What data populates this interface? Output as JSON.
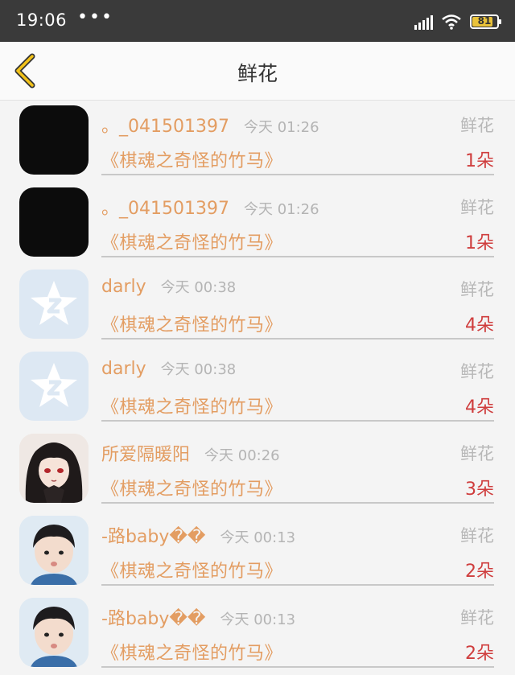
{
  "status": {
    "time": "19:06",
    "dots": "•••",
    "battery": "81"
  },
  "header": {
    "title": "鲜花"
  },
  "items": [
    {
      "avatar": "black",
      "name": "。_041501397",
      "time": "今天 01:26",
      "type": "鲜花",
      "book": "《棋魂之奇怪的竹马》",
      "count": "1朵"
    },
    {
      "avatar": "black",
      "name": "。_041501397",
      "time": "今天 01:26",
      "type": "鲜花",
      "book": "《棋魂之奇怪的竹马》",
      "count": "1朵"
    },
    {
      "avatar": "qq-default",
      "name": "darly",
      "time": "今天 00:38",
      "type": "鲜花",
      "book": "《棋魂之奇怪的竹马》",
      "count": "4朵"
    },
    {
      "avatar": "qq-default",
      "name": "darly",
      "time": "今天 00:38",
      "type": "鲜花",
      "book": "《棋魂之奇怪的竹马》",
      "count": "4朵"
    },
    {
      "avatar": "anime",
      "name": "所爱隔暖阳",
      "time": "今天 00:26",
      "type": "鲜花",
      "book": "《棋魂之奇怪的竹马》",
      "count": "3朵"
    },
    {
      "avatar": "boy",
      "name": "-路baby��",
      "time": "今天 00:13",
      "type": "鲜花",
      "book": "《棋魂之奇怪的竹马》",
      "count": "2朵"
    },
    {
      "avatar": "boy",
      "name": "-路baby��",
      "time": "今天 00:13",
      "type": "鲜花",
      "book": "《棋魂之奇怪的竹马》",
      "count": "2朵"
    }
  ]
}
